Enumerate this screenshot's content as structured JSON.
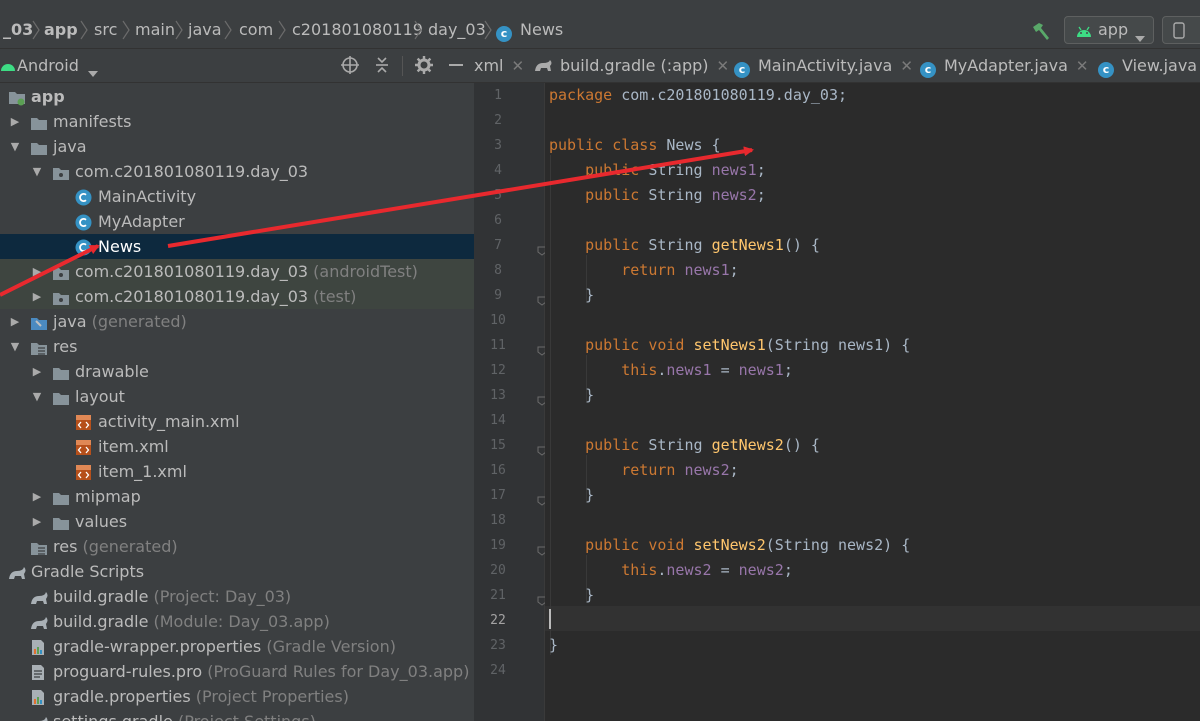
{
  "top_strip": {
    "text": ""
  },
  "breadcrumb": [
    "_03",
    "app",
    "src",
    "main",
    "java",
    "com",
    "c201801080119",
    "day_03",
    "News"
  ],
  "run_config": {
    "label": "app"
  },
  "project_view": {
    "label": "Android"
  },
  "tabs": [
    {
      "label": "xml",
      "icon": "xml-file-icon"
    },
    {
      "label": "build.gradle (:app)",
      "icon": "gradle-icon"
    },
    {
      "label": "MainActivity.java",
      "icon": "class-icon"
    },
    {
      "label": "MyAdapter.java",
      "icon": "class-icon"
    },
    {
      "label": "View.java",
      "icon": "class-icon"
    }
  ],
  "tree": [
    {
      "label": "app",
      "hint": "",
      "depth": 0,
      "icon": "module-folder-icon",
      "expand": "none",
      "bold": true
    },
    {
      "label": "manifests",
      "hint": "",
      "depth": 1,
      "icon": "folder-icon",
      "expand": "closed"
    },
    {
      "label": "java",
      "hint": "",
      "depth": 1,
      "icon": "folder-icon",
      "expand": "open"
    },
    {
      "label": "com.c201801080119.day_03",
      "hint": "",
      "depth": 2,
      "icon": "package-icon",
      "expand": "open"
    },
    {
      "label": "MainActivity",
      "hint": "",
      "depth": 3,
      "icon": "class-icon",
      "expand": "none"
    },
    {
      "label": "MyAdapter",
      "hint": "",
      "depth": 3,
      "icon": "class-icon",
      "expand": "none"
    },
    {
      "label": "News",
      "hint": "",
      "depth": 3,
      "icon": "class-icon",
      "expand": "none",
      "selected": true
    },
    {
      "label": "com.c201801080119.day_03",
      "hint": "(androidTest)",
      "depth": 2,
      "icon": "package-icon",
      "expand": "closed",
      "test": true
    },
    {
      "label": "com.c201801080119.day_03",
      "hint": "(test)",
      "depth": 2,
      "icon": "package-icon",
      "expand": "closed",
      "test": true
    },
    {
      "label": "java",
      "hint": "(generated)",
      "depth": 1,
      "icon": "generated-folder-icon",
      "expand": "closed"
    },
    {
      "label": "res",
      "hint": "",
      "depth": 1,
      "icon": "res-folder-icon",
      "expand": "open"
    },
    {
      "label": "drawable",
      "hint": "",
      "depth": 2,
      "icon": "folder-icon",
      "expand": "closed"
    },
    {
      "label": "layout",
      "hint": "",
      "depth": 2,
      "icon": "folder-icon",
      "expand": "open"
    },
    {
      "label": "activity_main.xml",
      "hint": "",
      "depth": 3,
      "icon": "layout-xml-icon",
      "expand": "none"
    },
    {
      "label": "item.xml",
      "hint": "",
      "depth": 3,
      "icon": "layout-xml-icon",
      "expand": "none"
    },
    {
      "label": "item_1.xml",
      "hint": "",
      "depth": 3,
      "icon": "layout-xml-icon",
      "expand": "none"
    },
    {
      "label": "mipmap",
      "hint": "",
      "depth": 2,
      "icon": "folder-icon",
      "expand": "closed"
    },
    {
      "label": "values",
      "hint": "",
      "depth": 2,
      "icon": "folder-icon",
      "expand": "closed"
    },
    {
      "label": "res",
      "hint": "(generated)",
      "depth": 1,
      "icon": "res-folder-icon",
      "expand": "none"
    },
    {
      "label": "Gradle Scripts",
      "hint": "",
      "depth": 0,
      "icon": "gradle-icon",
      "expand": "none"
    },
    {
      "label": "build.gradle",
      "hint": "(Project: Day_03)",
      "depth": 1,
      "icon": "gradle-icon",
      "expand": "none"
    },
    {
      "label": "build.gradle",
      "hint": "(Module: Day_03.app)",
      "depth": 1,
      "icon": "gradle-icon",
      "expand": "none"
    },
    {
      "label": "gradle-wrapper.properties",
      "hint": "(Gradle Version)",
      "depth": 1,
      "icon": "properties-icon",
      "expand": "none"
    },
    {
      "label": "proguard-rules.pro",
      "hint": "(ProGuard Rules for Day_03.app)",
      "depth": 1,
      "icon": "text-file-icon",
      "expand": "none"
    },
    {
      "label": "gradle.properties",
      "hint": "(Project Properties)",
      "depth": 1,
      "icon": "properties-icon",
      "expand": "none"
    },
    {
      "label": "settings.gradle",
      "hint": "(Project Settings)",
      "depth": 1,
      "icon": "gradle-icon",
      "expand": "none"
    }
  ],
  "editor": {
    "current_line": 22,
    "lines": [
      "package com.c201801080119.day_03;",
      "",
      "public class News {",
      "    public String news1;",
      "    public String news2;",
      "",
      "    public String getNews1() {",
      "        return news1;",
      "    }",
      "",
      "    public void setNews1(String news1) {",
      "        this.news1 = news1;",
      "    }",
      "",
      "    public String getNews2() {",
      "        return news2;",
      "    }",
      "",
      "    public void setNews2(String news2) {",
      "        this.news2 = news2;",
      "    }",
      "",
      "}",
      ""
    ]
  },
  "colors": {
    "keyword": "#cc7832",
    "field": "#9876aa",
    "method": "#ffc66d",
    "plain": "#a9b7c6",
    "annotation_arrow": "#e8292e"
  }
}
